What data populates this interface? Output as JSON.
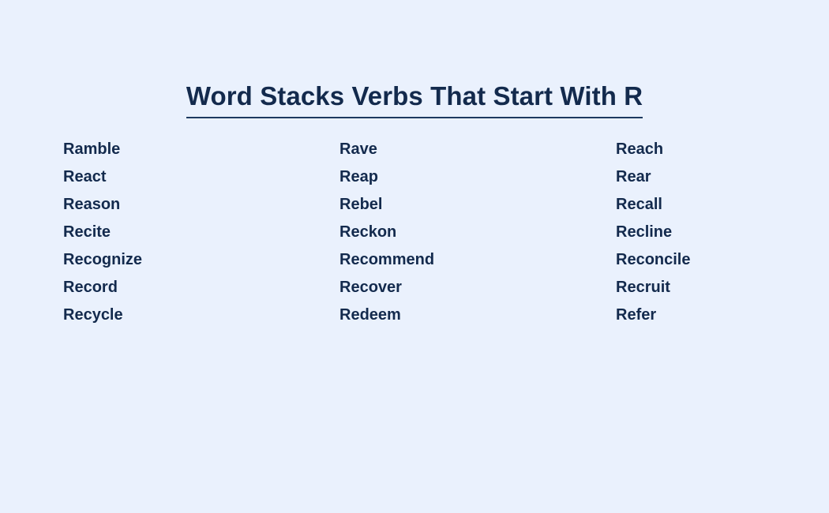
{
  "header": {
    "title": "Word Stacks Verbs That Start With R"
  },
  "colors": {
    "background": "#eaf1fd",
    "text": "#132a4d",
    "underline": "#1d3a5f"
  },
  "word_list": {
    "columns": [
      {
        "words": [
          "Ramble",
          "React",
          "Reason",
          "Recite",
          "Recognize",
          "Record",
          "Recycle"
        ]
      },
      {
        "words": [
          "Rave",
          "Reap",
          "Rebel",
          "Reckon",
          "Recommend",
          "Recover",
          "Redeem"
        ]
      },
      {
        "words": [
          "Reach",
          "Rear",
          "Recall",
          "Recline",
          "Reconcile",
          "Recruit",
          "Refer"
        ]
      }
    ]
  }
}
